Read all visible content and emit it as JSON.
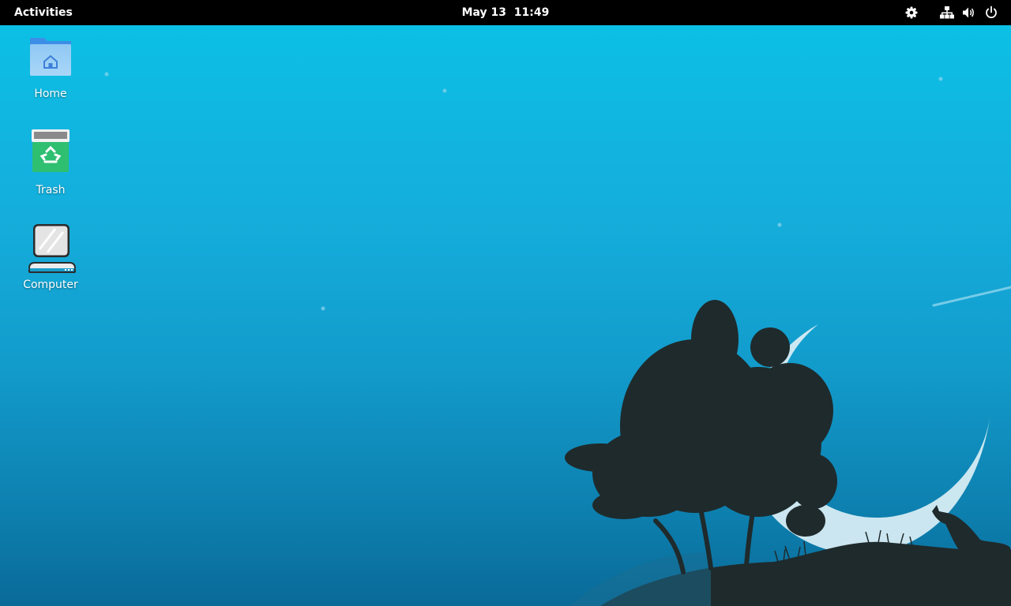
{
  "top_bar": {
    "activities_label": "Activities",
    "date": "May 13",
    "time": "11:49",
    "tray_icons": [
      "settings-gear-icon",
      "network-wired-icon",
      "volume-icon",
      "power-icon"
    ]
  },
  "desktop": {
    "icons": [
      {
        "label": "Home",
        "icon": "home-folder-icon"
      },
      {
        "label": "Trash",
        "icon": "trash-icon"
      },
      {
        "label": "Computer",
        "icon": "computer-icon"
      }
    ]
  },
  "colors": {
    "top_bar_bg": "#000000",
    "sky_top": "#0bc2e6",
    "sky_bottom": "#0a6a98",
    "silhouette": "#1f2a2c",
    "moon": "#d6ecf3"
  }
}
